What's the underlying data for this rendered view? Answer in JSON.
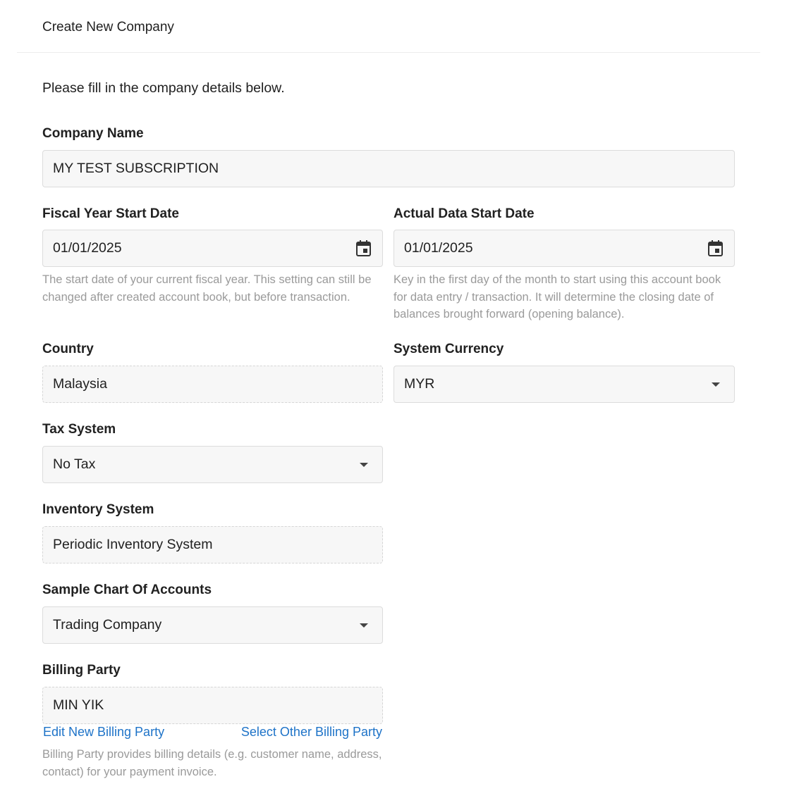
{
  "header": {
    "title": "Create New Company"
  },
  "intro_text": "Please fill in the company details below.",
  "company_name": {
    "label": "Company Name",
    "value": "MY TEST SUBSCRIPTION"
  },
  "fiscal_year_start": {
    "label": "Fiscal Year Start Date",
    "value": "01/01/2025",
    "help_lines": [
      "The start date of your current fiscal year. This setting can still be",
      "changed after created account book, but before transaction."
    ]
  },
  "actual_data_start": {
    "label": "Actual Data Start Date",
    "value": "01/01/2025",
    "help_lines": [
      "Key in the first day of the month to start using this account book",
      "for data entry / transaction. It will determine the closing date of",
      "balances brought forward (opening balance)."
    ]
  },
  "country": {
    "label": "Country",
    "value": "Malaysia"
  },
  "system_currency": {
    "label": "System Currency",
    "value": "MYR"
  },
  "tax_system": {
    "label": "Tax System",
    "value": "No Tax"
  },
  "inventory_system": {
    "label": "Inventory System",
    "value": "Periodic Inventory System"
  },
  "sample_chart_of_accounts": {
    "label": "Sample Chart Of Accounts",
    "value": "Trading Company"
  },
  "billing_party": {
    "label": "Billing Party",
    "value": "MIN YIK",
    "edit_link": "Edit New Billing Party",
    "select_link": "Select Other Billing Party",
    "help_lines": [
      "Billing Party provides billing details (e.g. customer name, address,",
      "contact) for your payment invoice."
    ]
  },
  "icons": {
    "calendar": "calendar-icon",
    "dropdown": "caret-down-icon"
  },
  "colors": {
    "link": "#1e73c8",
    "help_text": "#9a9a9a",
    "field_bg": "#f7f7f7"
  }
}
